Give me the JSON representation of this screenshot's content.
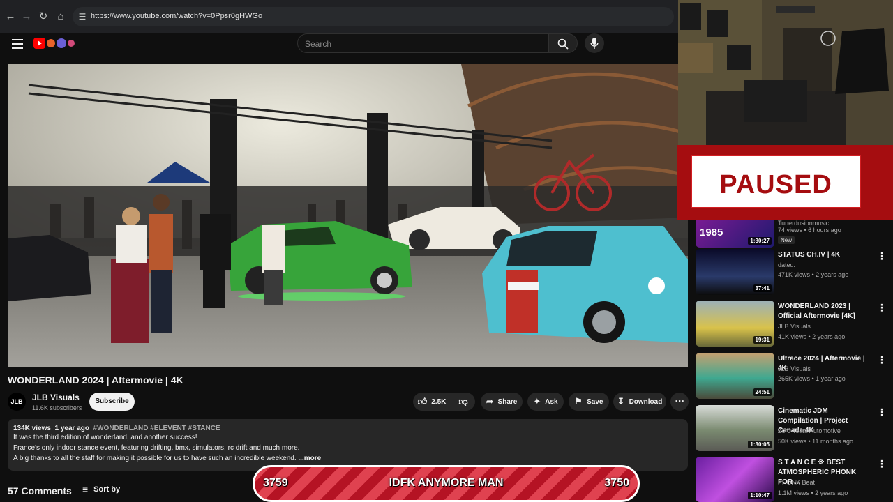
{
  "browser": {
    "url": "https://www.youtube.com/watch?v=0Ppsr0gHWGo",
    "back_icon": "arrow-left-icon",
    "forward_icon": "arrow-right-icon",
    "reload_icon": "reload-icon",
    "home_icon": "home-icon"
  },
  "header": {
    "search_placeholder": "Search"
  },
  "video": {
    "title": "WONDERLAND 2024 | Aftermovie | 4K",
    "channel": "JLB Visuals",
    "channel_avatar": "JLB",
    "subscribers": "11.6K subscribers",
    "subscribe_label": "Subscribe",
    "likes": "2.5K",
    "share_label": "Share",
    "ask_label": "Ask",
    "save_label": "Save",
    "download_label": "Download"
  },
  "description": {
    "views": "134K views",
    "age": "1 year ago",
    "tags": "#WONDERLAND #ELEVENT #STANCE",
    "line1": "It was the third edition of wonderland, and another success!",
    "line2": "France's only indoor stance event, featuring drifting, bmx, simulators, rc drift and much more.",
    "line3": "A big thanks to all the staff for making it possible for us to have such an incredible weekend.",
    "more_label": "...more"
  },
  "comments": {
    "count_label": "57 Comments",
    "sort_label": "Sort by"
  },
  "overlay": {
    "left_count": "3759",
    "text": "IDFK ANYMORE MAN",
    "right_count": "3750"
  },
  "paused_sign": "PAUSED",
  "recommendations": [
    {
      "title": "",
      "channel": "Tunerdusionmusic",
      "stats": "74 views • 6 hours ago",
      "badge": "New",
      "duration": "1:30:27",
      "thumb_text": "1985"
    },
    {
      "title": "STATUS CH.IV  | 4K",
      "channel": "dated.",
      "stats": "471K views • 2 years ago",
      "duration": "37:41"
    },
    {
      "title": "WONDERLAND 2023 | Official Aftermovie [4K]",
      "channel": "JLB Visuals",
      "stats": "41K views • 2 years ago",
      "duration": "19:31"
    },
    {
      "title": "Ultrace 2024 | Aftermovie | 4K",
      "channel": "JLB Visuals",
      "stats": "265K views • 1 year ago",
      "duration": "24:51"
    },
    {
      "title": "Cinematic JDM Compilation | Project Canada 4K",
      "channel": "Zero Team Automotive",
      "stats": "50K views • 11 months ago",
      "duration": "1:30:05"
    },
    {
      "title": "S T A N C E ※ BEST ATMOSPHERIC PHONK FOR ...",
      "channel": "PHONK Beat",
      "stats": "1.1M views • 2 years ago",
      "duration": "1:10:47"
    }
  ],
  "colors": {
    "bg": "#0f0f0f",
    "yt_red": "#ff0000",
    "paused_red": "#a50d10",
    "overlay_red": "#b51324"
  }
}
